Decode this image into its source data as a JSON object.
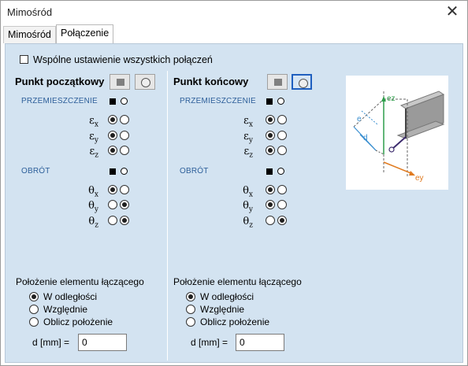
{
  "window": {
    "title": "Mimośród",
    "close_icon": "close-icon"
  },
  "tabs": [
    {
      "label": "Mimośród"
    },
    {
      "label": "Połączenie"
    }
  ],
  "common": {
    "label": "Wspólne ustawienie wszystkich połączeń",
    "checked": false
  },
  "start": {
    "header": "Punkt początkowy",
    "displacement_label": "PRZEMIESZCZENIE",
    "rotation_label": "OBRÓT",
    "position_label": "Położenie elementu łączącego",
    "options": [
      "W odległości",
      "Względnie",
      "Oblicz położenie"
    ],
    "selected_option": 0,
    "d_label": "d [mm] =",
    "d_value": "0"
  },
  "end": {
    "header": "Punkt końcowy",
    "displacement_label": "PRZEMIESZCZENIE",
    "rotation_label": "OBRÓT",
    "position_label": "Położenie elementu łączącego",
    "options": [
      "W odległości",
      "Względnie",
      "Oblicz położenie"
    ],
    "selected_option": 0,
    "d_label": "d [mm] =",
    "d_value": "0"
  },
  "rows": {
    "ex": {
      "sym": "ε",
      "sub": "x"
    },
    "ey": {
      "sym": "ε",
      "sub": "y"
    },
    "ez": {
      "sym": "ε",
      "sub": "z"
    },
    "tx": {
      "sym": "θ",
      "sub": "x"
    },
    "ty": {
      "sym": "θ",
      "sub": "y"
    },
    "tz": {
      "sym": "θ",
      "sub": "z"
    }
  },
  "diagram": {
    "labels": {
      "e": "e",
      "d": "d",
      "ez": "ez",
      "ey": "ey"
    }
  }
}
